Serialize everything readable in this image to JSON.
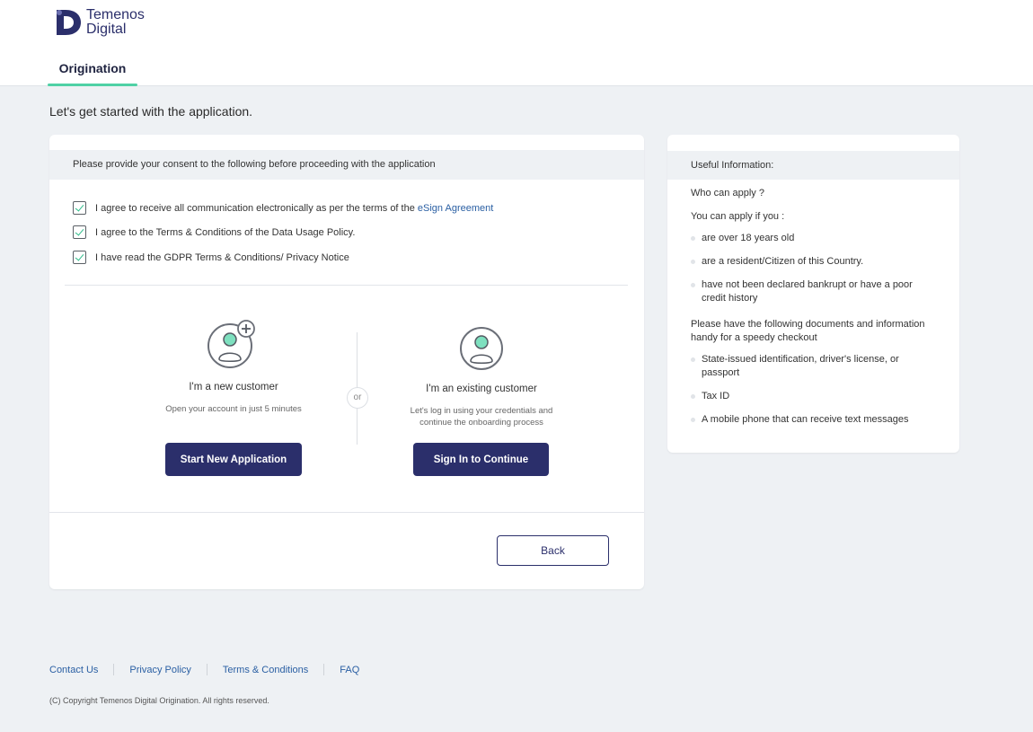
{
  "brand": {
    "line1": "Temenos",
    "line2": "Digital",
    "color": "#2b2f6b",
    "accent": "#4fd1a5"
  },
  "nav": {
    "active_tab": "Origination"
  },
  "page": {
    "heading": "Let's get started with the application."
  },
  "consent": {
    "header": "Please provide your consent to the following before proceeding with the application",
    "items": [
      {
        "text": "I agree to receive all communication electronically as per the terms of the ",
        "link": "eSign Agreement",
        "checked": true
      },
      {
        "text": "I agree to the Terms & Conditions of the Data Usage Policy.",
        "checked": true
      },
      {
        "text": "I have read the GDPR Terms & Conditions/ Privacy Notice",
        "checked": true
      }
    ],
    "new_customer": {
      "icon": "add-user-icon",
      "title": "I'm a new customer",
      "subtitle": "Open your account in just 5 minutes",
      "button": "Start New Application"
    },
    "or_label": "or",
    "existing_customer": {
      "icon": "user-icon",
      "title": "I'm an existing customer",
      "subtitle_line1": "Let's log in using your credentials and",
      "subtitle_line2": "continue the onboarding process",
      "button": "Sign In to Continue"
    },
    "back_button": "Back"
  },
  "info": {
    "header": "Useful Information:",
    "who_can_apply": "Who can apply ?",
    "you_can_apply": "You can apply if you :",
    "criteria": [
      "are over 18 years old",
      "are a resident/Citizen of this Country.",
      "have not been declared bankrupt or have a poor credit history"
    ],
    "documents_intro": "Please have the following documents and information handy for a speedy checkout",
    "documents": [
      "State-issued identification, driver's license,  or passport",
      "Tax ID",
      "A mobile phone that can receive text messages"
    ]
  },
  "footer": {
    "links": [
      "Contact Us",
      "Privacy Policy",
      "Terms & Conditions",
      "FAQ"
    ],
    "copyright": "(C) Copyright Temenos Digital Origination. All rights reserved."
  }
}
